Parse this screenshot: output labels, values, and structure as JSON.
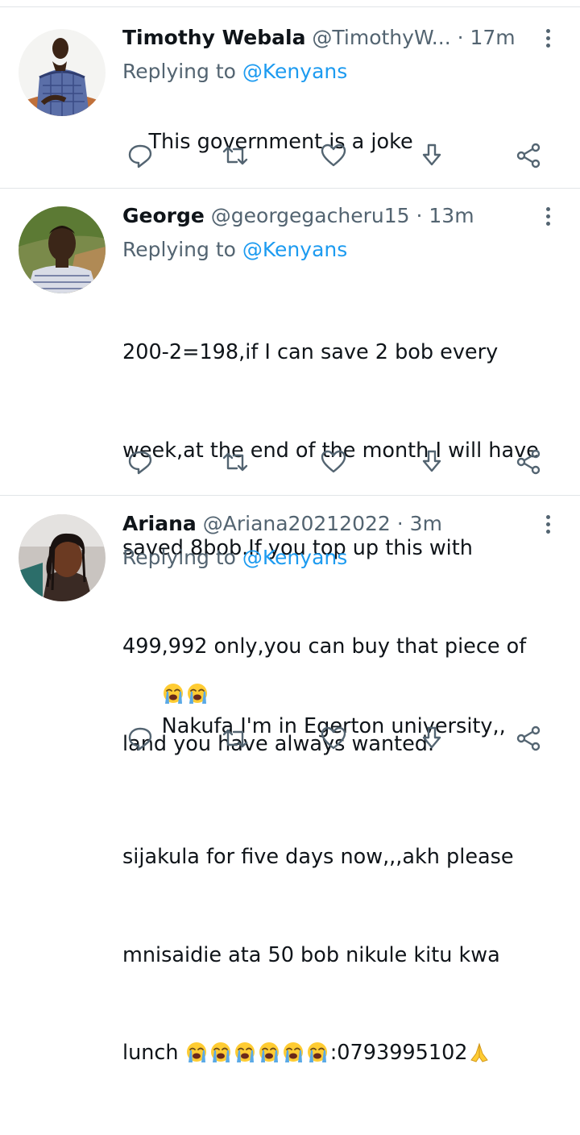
{
  "tweets": [
    {
      "name": "Timothy Webala",
      "handle": "@TimothyW...",
      "dot": "·",
      "time": "17m",
      "replying_prefix": "Replying to",
      "replying_to": "@Kenyans",
      "text": "This government is a joke",
      "avatar_icon": "user-photo-avatar",
      "actions": [
        "reply-icon",
        "retweet-icon",
        "like-icon",
        "download-icon",
        "share-icon"
      ]
    },
    {
      "name": "George",
      "handle": "@georgegacheru15",
      "dot": "·",
      "time": "13m",
      "replying_prefix": "Replying to",
      "replying_to": "@Kenyans",
      "text_lines": [
        "200-2=198,if I can save 2 bob every",
        "week,at the end of the month I will have",
        "saved 8bob.If you top up this with",
        "499,992 only,you can buy that piece of",
        "land you have always wanted."
      ],
      "avatar_icon": "user-photo-avatar",
      "actions": [
        "reply-icon",
        "retweet-icon",
        "like-icon",
        "download-icon",
        "share-icon"
      ]
    },
    {
      "name": "Ariana",
      "handle": "@Ariana20212022",
      "dot": "·",
      "time": "3m",
      "replying_prefix": "Replying to",
      "replying_to": "@Kenyans",
      "text_line1": "Nakufa I'm in Egerton university,,",
      "text_line2": "sijakula for five days now,,,akh please",
      "text_line3": "mnisaidie ata 50 bob nikule kitu kwa",
      "text_line4_start": "lunch",
      "text_line4_end": ":0793995102",
      "emoji_leading": "loudly-crying-face-emoji x2",
      "emoji_trailing": "loudly-crying-face-emoji x6",
      "emoji_end": "folded-hands-emoji",
      "avatar_icon": "user-photo-avatar",
      "actions": [
        "reply-icon",
        "retweet-icon",
        "like-icon",
        "download-icon",
        "share-icon"
      ]
    }
  ],
  "colors": {
    "text": "#0f1419",
    "secondary": "#536471",
    "mention": "#1d9bf0",
    "divider": "#e1e5e8",
    "emoji_yellow": "#ffcc33",
    "emoji_tear": "#5aa9e6"
  }
}
